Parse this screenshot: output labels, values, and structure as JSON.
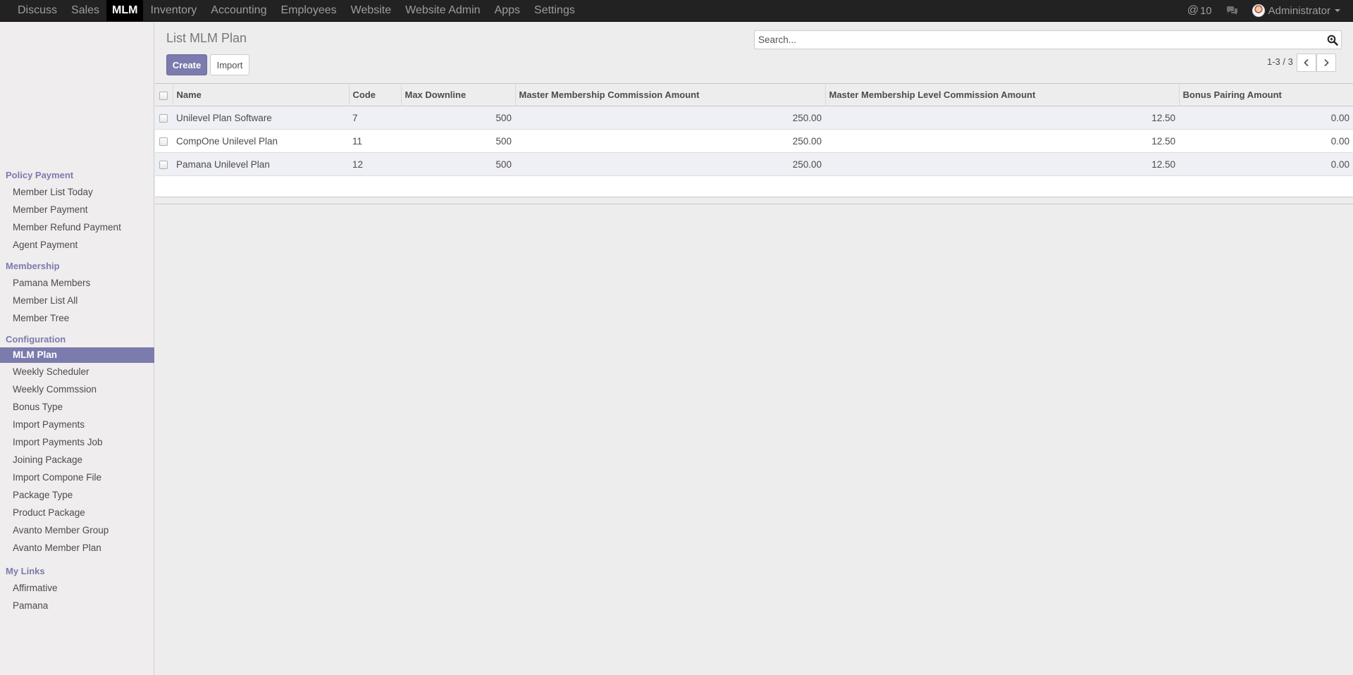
{
  "topnav": {
    "items": [
      {
        "label": "Discuss"
      },
      {
        "label": "Sales"
      },
      {
        "label": "MLM",
        "active": true
      },
      {
        "label": "Inventory"
      },
      {
        "label": "Accounting"
      },
      {
        "label": "Employees"
      },
      {
        "label": "Website"
      },
      {
        "label": "Website Admin"
      },
      {
        "label": "Apps"
      },
      {
        "label": "Settings"
      }
    ],
    "mentions_count": "10",
    "user_name": "Administrator"
  },
  "sidebar": {
    "sections": [
      {
        "header": "Policy Payment",
        "items": [
          "Member List Today",
          "Member Payment",
          "Member Refund Payment",
          "Agent Payment"
        ]
      },
      {
        "header": "Membership",
        "items": [
          "Pamana Members",
          "Member List All",
          "Member Tree"
        ]
      },
      {
        "header": "Configuration",
        "items": [
          "MLM Plan",
          "Weekly Scheduler",
          "Weekly Commssion",
          "Bonus Type",
          "Import Payments",
          "Import Payments Job",
          "Joining Package",
          "Import Compone File",
          "Package Type",
          "Product Package",
          "Avanto Member Group",
          "Avanto Member Plan"
        ]
      },
      {
        "header": "My Links",
        "items": [
          "Affirmative",
          "Pamana"
        ]
      }
    ],
    "active_item": "MLM Plan"
  },
  "main": {
    "title": "List MLM Plan",
    "create_label": "Create",
    "import_label": "Import",
    "search_placeholder": "Search...",
    "pager_text": "1-3 / 3"
  },
  "table": {
    "columns": [
      "Name",
      "Code",
      "Max Downline",
      "Master Membership Commission Amount",
      "Master Membership Level Commission Amount",
      "Bonus Pairing Amount"
    ],
    "rows": [
      [
        "Unilevel Plan Software",
        "7",
        "500",
        "250.00",
        "12.50",
        "0.00"
      ],
      [
        "CompOne Unilevel Plan",
        "11",
        "500",
        "250.00",
        "12.50",
        "0.00"
      ],
      [
        "Pamana Unilevel Plan",
        "12",
        "500",
        "250.00",
        "12.50",
        "0.00"
      ]
    ]
  },
  "colors": {
    "accent": "#7c7bad",
    "topbar": "#222222",
    "background": "#eeeded"
  }
}
